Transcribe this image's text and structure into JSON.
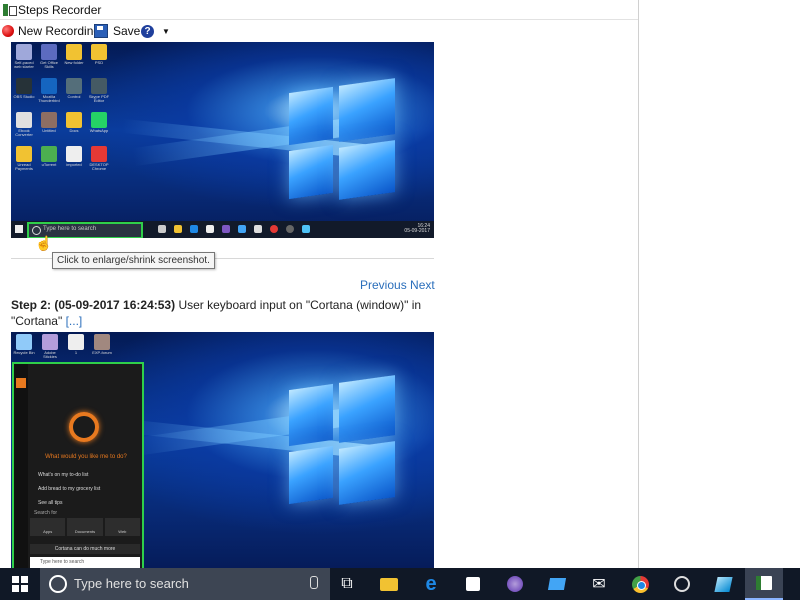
{
  "window": {
    "title": "Steps Recorder"
  },
  "toolbar": {
    "new_recording": "New Recording",
    "save": "Save",
    "help_icon": "help-icon",
    "record_color": "#d11111"
  },
  "screenshot1": {
    "desktop_icons": [
      {
        "label": "Self-paced web starter"
      },
      {
        "label": "Get Office Skills"
      },
      {
        "label": "New folder"
      },
      {
        "label": "PSD"
      },
      {
        "label": "OBS Studio"
      },
      {
        "label": "Mozilla Thunderbird"
      },
      {
        "label": "Control"
      },
      {
        "label": "Skype PDF Editor"
      },
      {
        "label": "Ebook Converter"
      },
      {
        "label": "Untitled"
      },
      {
        "label": "Docs"
      },
      {
        "label": "WhatsApp"
      },
      {
        "label": "Unread Payments"
      },
      {
        "label": "uTorrent"
      },
      {
        "label": "imported"
      },
      {
        "label": "DESKTOP Chrome"
      }
    ],
    "taskbar_search": "Type here to search",
    "clock": "16:24",
    "date": "05-09-2017"
  },
  "tooltip": "Click to enlarge/shrink screenshot.",
  "nav": {
    "previous": "Previous",
    "next": "Next"
  },
  "step": {
    "header": "Step 2: (05-09-2017 16:24:53)",
    "description": "User keyboard input on \"Cortana (window)\" in \"Cortana\"",
    "more": "[...]"
  },
  "screenshot2": {
    "desktop_icons": [
      {
        "label": "Recycle Bin"
      },
      {
        "label": "Adobe Stickies"
      },
      {
        "label": "1"
      },
      {
        "label": "EXP-forum"
      }
    ],
    "cortana": {
      "question": "What would you like me to do?",
      "options": [
        "What's on my to-do list",
        "Add bread to my grocery list",
        "See all tips"
      ],
      "search_for": "Search for",
      "tiles": [
        "Apps",
        "Documents",
        "Web"
      ],
      "mode_bar": "Cortana can do much more",
      "search_placeholder": "Type here to search",
      "accent": "#e8791f"
    }
  },
  "taskbar": {
    "search_placeholder": "Type here to search",
    "icons": [
      "task-view-icon",
      "file-explorer-icon",
      "edge-icon",
      "store-icon",
      "tor-icon",
      "network-icon",
      "mail-icon",
      "chrome-icon",
      "camera-icon",
      "app-icon",
      "steps-recorder-icon"
    ]
  },
  "colors": {
    "link": "#2a6ebb",
    "highlight": "#2fcf4a",
    "taskbar": "#101826"
  }
}
